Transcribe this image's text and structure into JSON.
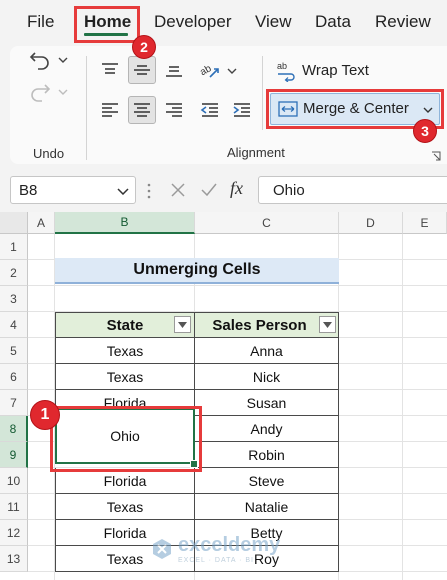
{
  "tabs": [
    {
      "label": "File",
      "active": false
    },
    {
      "label": "Home",
      "active": true
    },
    {
      "label": "Developer",
      "active": false
    },
    {
      "label": "View",
      "active": false
    },
    {
      "label": "Data",
      "active": false
    },
    {
      "label": "Review",
      "active": false
    }
  ],
  "ribbon": {
    "undo_group_label": "Undo",
    "alignment_group_label": "Alignment",
    "wrap_text_label": "Wrap Text",
    "merge_center_label": "Merge & Center"
  },
  "formula_bar": {
    "name_box_value": "B8",
    "formula_value": "Ohio",
    "fx_label": "fx"
  },
  "columns": [
    "A",
    "B",
    "C",
    "D",
    "E"
  ],
  "rows": [
    "1",
    "2",
    "3",
    "4",
    "5",
    "6",
    "7",
    "8",
    "9",
    "10",
    "11",
    "12",
    "13"
  ],
  "sheet": {
    "title": "Unmerging Cells",
    "headers": [
      "State",
      "Sales Person"
    ],
    "rows": [
      {
        "state": "Texas",
        "person": "Anna"
      },
      {
        "state": "Texas",
        "person": "Nick"
      },
      {
        "state": "Florida",
        "person": "Susan"
      },
      {
        "state": "Ohio",
        "person": "Andy"
      },
      {
        "state": "",
        "person": "Robin"
      },
      {
        "state": "Florida",
        "person": "Steve"
      },
      {
        "state": "Texas",
        "person": "Natalie"
      },
      {
        "state": "Florida",
        "person": "Betty"
      },
      {
        "state": "Texas",
        "person": "Roy"
      }
    ],
    "merged_value": "Ohio"
  },
  "callouts": [
    "1",
    "2",
    "3"
  ],
  "watermark": {
    "brand": "exceldemy",
    "tagline": "EXCEL · DATA · BI"
  },
  "colors": {
    "accent": "#217346",
    "callout": "#e0282e",
    "table_header": "#e2efda",
    "title_fill": "#dde9f6"
  }
}
